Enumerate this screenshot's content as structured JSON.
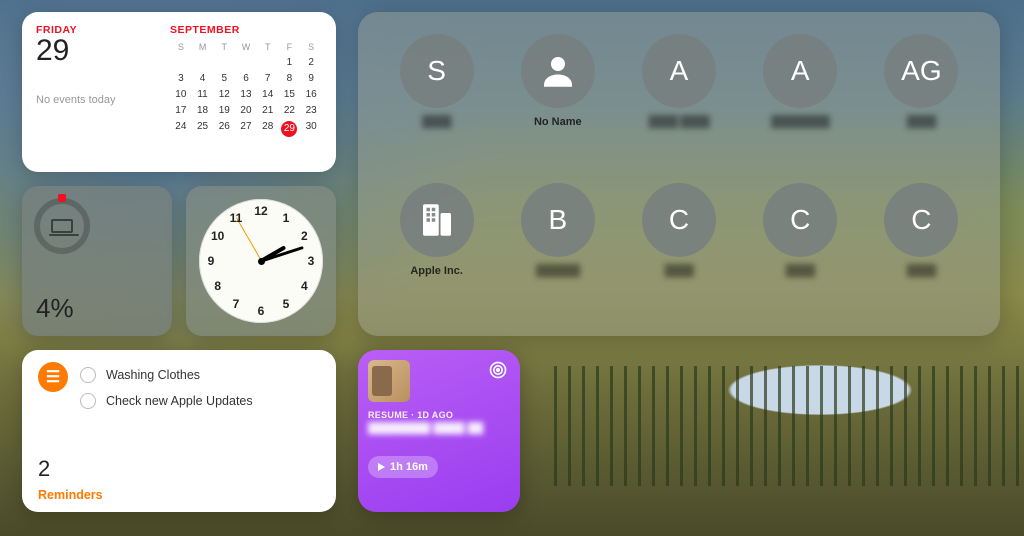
{
  "calendar": {
    "day_name": "FRIDAY",
    "day_num": "29",
    "events_text": "No events today",
    "month": "SEPTEMBER",
    "dow": [
      "S",
      "M",
      "T",
      "W",
      "T",
      "F",
      "S"
    ],
    "weeks": [
      [
        "",
        "",
        "",
        "",
        "",
        "1",
        "2"
      ],
      [
        "3",
        "4",
        "5",
        "6",
        "7",
        "8",
        "9"
      ],
      [
        "10",
        "11",
        "12",
        "13",
        "14",
        "15",
        "16"
      ],
      [
        "17",
        "18",
        "19",
        "20",
        "21",
        "22",
        "23"
      ],
      [
        "24",
        "25",
        "26",
        "27",
        "28",
        "29",
        "30"
      ]
    ],
    "today": "29"
  },
  "battery": {
    "percent": "4%"
  },
  "clock": {
    "numbers": [
      "12",
      "1",
      "2",
      "3",
      "4",
      "5",
      "6",
      "7",
      "8",
      "9",
      "10",
      "11"
    ],
    "hour_angle": 60,
    "minute_angle": 72,
    "second_angle": 330
  },
  "reminders": {
    "items": [
      "Washing Clothes",
      "Check new Apple Updates"
    ],
    "count": "2",
    "title": "Reminders"
  },
  "contacts": {
    "row1": [
      {
        "avatar": "S",
        "name": "████",
        "blur": true,
        "kind": "letter"
      },
      {
        "avatar": "profile",
        "name": "No Name",
        "blur": false,
        "kind": "icon"
      },
      {
        "avatar": "A",
        "name": "████ ████",
        "blur": true,
        "kind": "letter"
      },
      {
        "avatar": "A",
        "name": "████████",
        "blur": true,
        "kind": "letter"
      },
      {
        "avatar": "AG",
        "name": "████",
        "blur": true,
        "kind": "letter"
      }
    ],
    "row2": [
      {
        "avatar": "building",
        "name": "Apple Inc.",
        "blur": false,
        "kind": "icon"
      },
      {
        "avatar": "B",
        "name": "██████",
        "blur": true,
        "kind": "letter"
      },
      {
        "avatar": "C",
        "name": "████",
        "blur": true,
        "kind": "letter"
      },
      {
        "avatar": "C",
        "name": "████",
        "blur": true,
        "kind": "letter"
      },
      {
        "avatar": "C",
        "name": "████",
        "blur": true,
        "kind": "letter"
      }
    ]
  },
  "podcast": {
    "meta": "RESUME · 1D AGO",
    "title": "████████ ████ ██",
    "duration": "1h 16m"
  }
}
